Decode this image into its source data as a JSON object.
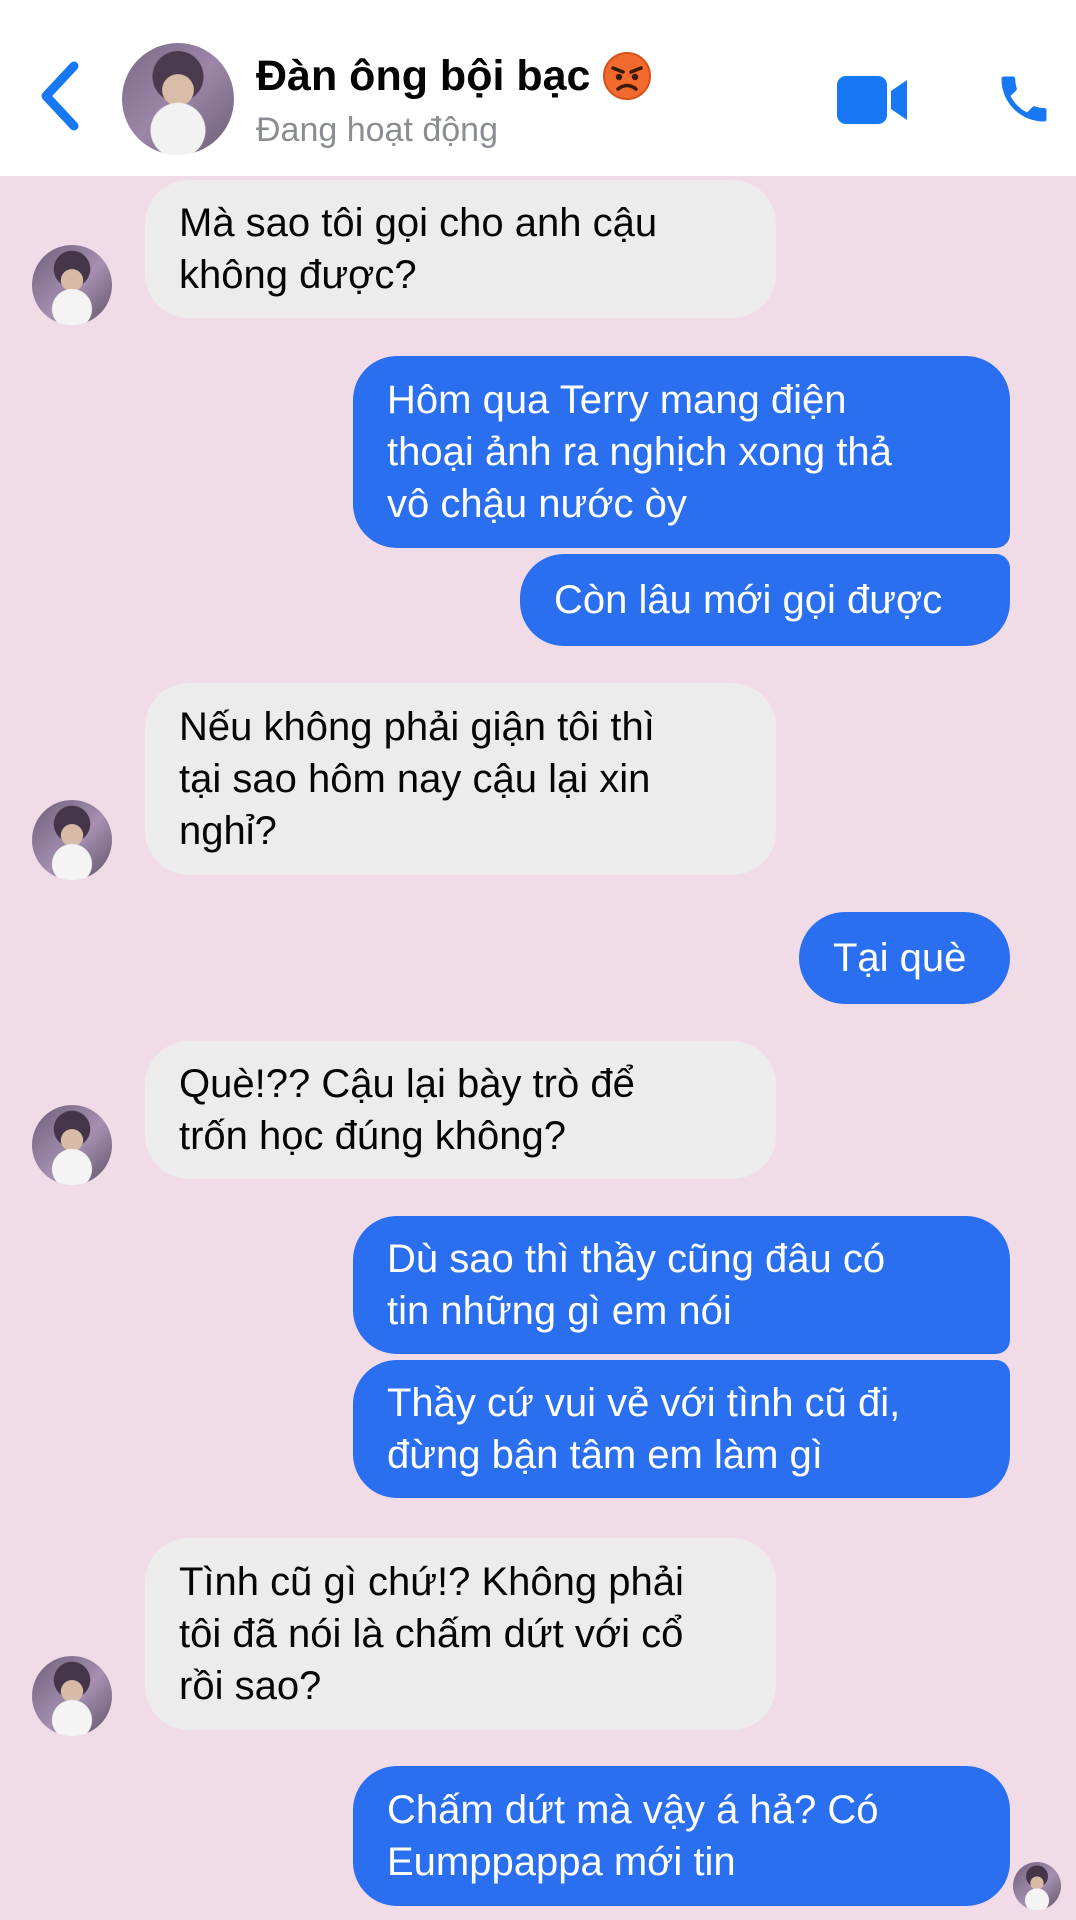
{
  "header": {
    "contact_name": "Đàn ông bội bạc",
    "status": "Đang hoạt động",
    "name_emoji": "angry-face-icon",
    "accent_color": "#1877f2"
  },
  "messages": [
    {
      "from": "them",
      "text": "Mà sao tôi gọi cho anh cậu\nkhông được?"
    },
    {
      "from": "me",
      "text": "Hôm qua Terry mang điện\nthoại ảnh ra nghịch xong thả\nvô chậu nước òy"
    },
    {
      "from": "me",
      "text": "Còn lâu mới gọi được"
    },
    {
      "from": "them",
      "text": "Nếu không phải giận tôi thì\ntại sao hôm nay cậu lại xin\nnghỉ?"
    },
    {
      "from": "me",
      "text": "Tại què"
    },
    {
      "from": "them",
      "text": "Què!?? Cậu lại bày trò để\ntrốn học đúng không?"
    },
    {
      "from": "me",
      "text": "Dù sao thì thầy cũng đâu có\ntin những gì em nói"
    },
    {
      "from": "me",
      "text": "Thầy cứ vui vẻ với tình cũ đi,\nđừng bận tâm em làm gì"
    },
    {
      "from": "them",
      "text": "Tình cũ gì chứ!? Không phải\ntôi đã nói là chấm dứt với cổ\nrồi sao?"
    },
    {
      "from": "me",
      "text": "Chấm dứt mà vậy á hả? Có\nEumppappa mới tin"
    }
  ],
  "colors": {
    "incoming_bubble": "#ececec",
    "outgoing_bubble": "#2a6ff0",
    "chat_background": "#f1dbe7"
  }
}
